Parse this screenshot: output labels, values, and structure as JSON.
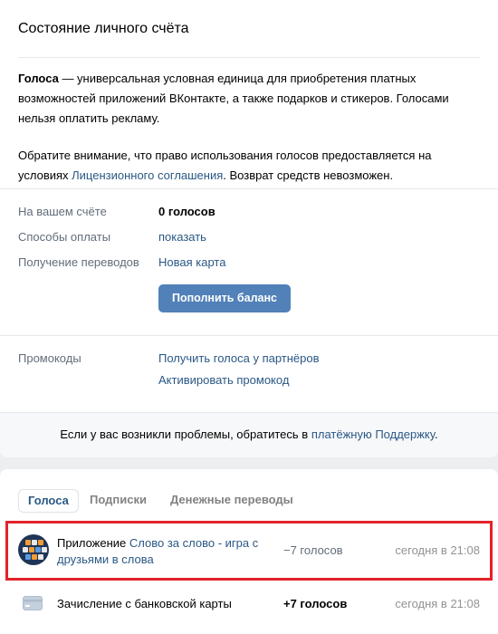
{
  "account": {
    "title": "Состояние личного счёта",
    "info_bold": "Голоса",
    "info_p1_rest": " — универсальная условная единица для приобретения платных возможностей приложений ВКонтакте, а также подарков и стикеров. Голосами нельзя оплатить рекламу.",
    "info_p2_start": "Обратите внимание, что право использования голосов предоставляется на условиях ",
    "info_p2_link": "Лицензионного соглашения",
    "info_p2_end": ". Возврат средств невозможен.",
    "balance_label": "На вашем счёте",
    "balance_value": "0 голосов",
    "payment_label": "Способы оплаты",
    "payment_link": "показать",
    "transfers_label": "Получение переводов",
    "transfers_link": "Новая карта",
    "topup_button": "Пополнить баланс",
    "promo_label": "Промокоды",
    "promo_partners_link": "Получить голоса у партнёров",
    "promo_activate_link": "Активировать промокод",
    "support_text_start": "Если у вас возникли проблемы, обратитесь в ",
    "support_link": "платёжную Поддержку",
    "support_text_end": "."
  },
  "history": {
    "tabs": [
      {
        "label": "Голоса",
        "active": true
      },
      {
        "label": "Подписки",
        "active": false
      },
      {
        "label": "Денежные переводы",
        "active": false
      }
    ],
    "rows": [
      {
        "prefix": "Приложение ",
        "link": "Слово за слово - игра с друзьями в слова",
        "amount": "−7 голосов",
        "date": "сегодня в 21:08",
        "icon": "app-word-game-icon",
        "highlighted": true
      },
      {
        "prefix": "Зачисление с банковской карты",
        "link": "",
        "amount": "+7 голосов",
        "date": "сегодня в 21:08",
        "icon": "bank-card-icon",
        "highlighted": false
      }
    ]
  },
  "colors": {
    "accent": "#5181b8",
    "link": "#2a5885",
    "highlight": "#e3232b"
  }
}
